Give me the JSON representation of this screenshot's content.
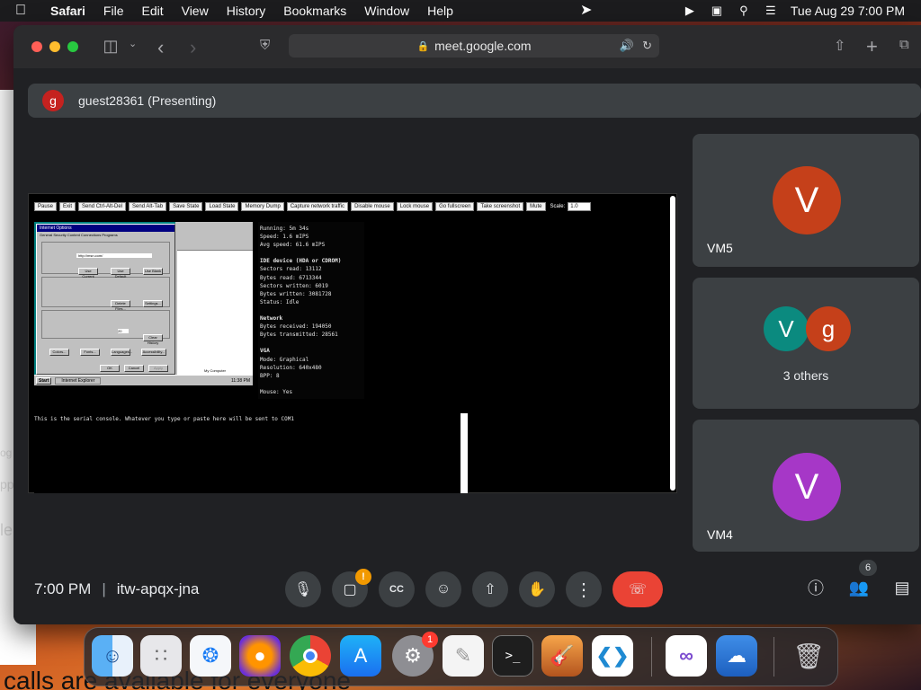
{
  "menubar": {
    "app_name": "Safari",
    "items": [
      "File",
      "Edit",
      "View",
      "History",
      "Bookmarks",
      "Window",
      "Help"
    ],
    "clock": "Tue Aug 29  7:00 PM"
  },
  "browser": {
    "url": "meet.google.com"
  },
  "meet": {
    "presenter": {
      "initial": "g",
      "label": "guest28361 (Presenting)"
    },
    "emulator": {
      "buttons": [
        "Pause",
        "Exit",
        "Send Ctrl-Alt-Del",
        "Send Alt-Tab",
        "Save State",
        "Load State",
        "Memory Dump",
        "Capture network traffic",
        "Disable mouse",
        "Lock mouse",
        "Go fullscreen",
        "Take screenshot",
        "Mute"
      ],
      "scale_label": "Scale:",
      "scale_value": "1.0",
      "stats": {
        "running": "Running: 5m 34s",
        "speed": "Speed: 1.6 mIPS",
        "avg_speed": "Avg speed: 61.6 mIPS",
        "ide_header": "IDE device (HDA or CDROM)",
        "sectors_read": "Sectors read: 13112",
        "bytes_read": "Bytes read: 6713344",
        "sectors_written": "Sectors written: 6019",
        "bytes_written": "Bytes written: 3081728",
        "ide_status": "Status: Idle",
        "network_header": "Network",
        "bytes_received": "Bytes received: 194050",
        "bytes_transmitted": "Bytes transmitted: 28561",
        "vga_header": "VGA",
        "vga_mode": "Mode: Graphical",
        "vga_resolution": "Resolution: 640x480",
        "vga_bpp": "BPP: 8",
        "mouse": "Mouse: Yes"
      },
      "serial_text": "This is the serial console. Whatever you type or paste here will be sent to COM1",
      "guest_screen": {
        "dialog_title": "Internet Options",
        "dialog_tabs": "General  Security  Content  Connections  Programs",
        "address_value": "http://msn.com/",
        "buttons": [
          "Use Current",
          "Use Default",
          "Use Blank",
          "Delete Files...",
          "Settings...",
          "Clear History",
          "Colors...",
          "Fonts...",
          "Languages...",
          "Accessibility...",
          "OK",
          "Cancel",
          "Apply"
        ],
        "history_days": "20",
        "taskbar_start": "Start",
        "taskbar_task": "Internet Explorer",
        "taskbar_time": "11:38 PM",
        "explorer_status": "My Computer"
      }
    },
    "participants": [
      {
        "name": "VM5",
        "initial": "V",
        "color": "#c5401a"
      },
      {
        "name": "3 others",
        "initials": [
          "V",
          "g"
        ],
        "colors": [
          "#0b8a7f",
          "#c5401a"
        ]
      },
      {
        "name": "VM4",
        "initial": "V",
        "color": "#a637c7"
      }
    ],
    "footer": {
      "time": "7:00 PM",
      "separator": "|",
      "meeting_code": "itw-apqx-jna",
      "camera_alert": "!",
      "people_count": "6"
    }
  },
  "dock": {
    "settings_badge": "1"
  },
  "background_text": {
    "side_top": "og",
    "side_mid": "pp",
    "side_low": "le",
    "bottom": "calls are available for everyone"
  },
  "colors": {
    "meet_bg": "#202124",
    "tile_bg": "#3c4043",
    "end_call": "#ea4335",
    "alert": "#f29900"
  }
}
